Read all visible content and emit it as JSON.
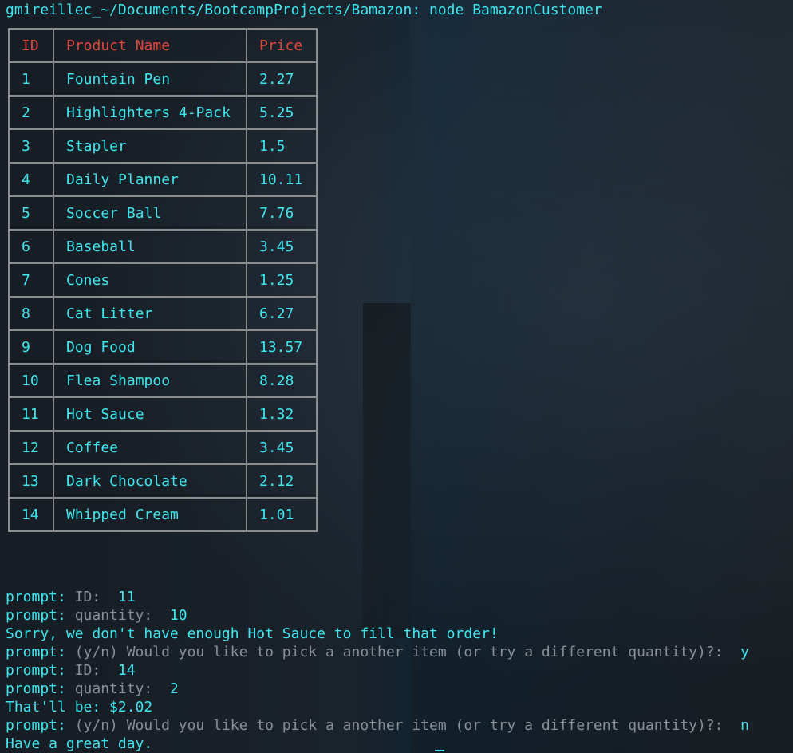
{
  "terminal": {
    "prompt_line": "gmireillec_~/Documents/BootcampProjects/Bamazon: node BamazonCustomer"
  },
  "table": {
    "headers": [
      "ID",
      "Product Name",
      "Price"
    ],
    "rows": [
      {
        "id": "1",
        "name": "Fountain Pen",
        "price": "2.27"
      },
      {
        "id": "2",
        "name": "Highlighters 4-Pack",
        "price": "5.25"
      },
      {
        "id": "3",
        "name": "Stapler",
        "price": "1.5"
      },
      {
        "id": "4",
        "name": "Daily Planner",
        "price": "10.11"
      },
      {
        "id": "5",
        "name": "Soccer Ball",
        "price": "7.76"
      },
      {
        "id": "6",
        "name": "Baseball",
        "price": "3.45"
      },
      {
        "id": "7",
        "name": "Cones",
        "price": "1.25"
      },
      {
        "id": "8",
        "name": "Cat Litter",
        "price": "6.27"
      },
      {
        "id": "9",
        "name": "Dog Food",
        "price": "13.57"
      },
      {
        "id": "10",
        "name": "Flea Shampoo",
        "price": "8.28"
      },
      {
        "id": "11",
        "name": "Hot Sauce",
        "price": "1.32"
      },
      {
        "id": "12",
        "name": "Coffee",
        "price": "3.45"
      },
      {
        "id": "13",
        "name": "Dark Chocolate",
        "price": "2.12"
      },
      {
        "id": "14",
        "name": "Whipped Cream",
        "price": "1.01"
      }
    ]
  },
  "output": [
    {
      "prefix": "prompt: ",
      "label": "ID:",
      "answer": "  11"
    },
    {
      "prefix": "prompt: ",
      "label": "quantity:",
      "answer": "  10"
    },
    {
      "text": "Sorry, we don't have enough Hot Sauce to fill that order!"
    },
    {
      "prefix": "prompt: ",
      "label": "(y/n) Would you like to pick a another item (or try a different quantity)?:",
      "answer": "  y"
    },
    {
      "prefix": "prompt: ",
      "label": "ID:",
      "answer": "  14"
    },
    {
      "prefix": "prompt: ",
      "label": "quantity:",
      "answer": "  2"
    },
    {
      "text": "That'll be: $2.02"
    },
    {
      "prefix": "prompt: ",
      "label": "(y/n) Would you like to pick a another item (or try a different quantity)?:",
      "answer": "  n"
    },
    {
      "text": "Have a great day."
    }
  ],
  "colors": {
    "text": "#3fe6ee",
    "header": "#e2453c",
    "prompt_label": "#8a9097",
    "border": "#8c8c8c"
  }
}
